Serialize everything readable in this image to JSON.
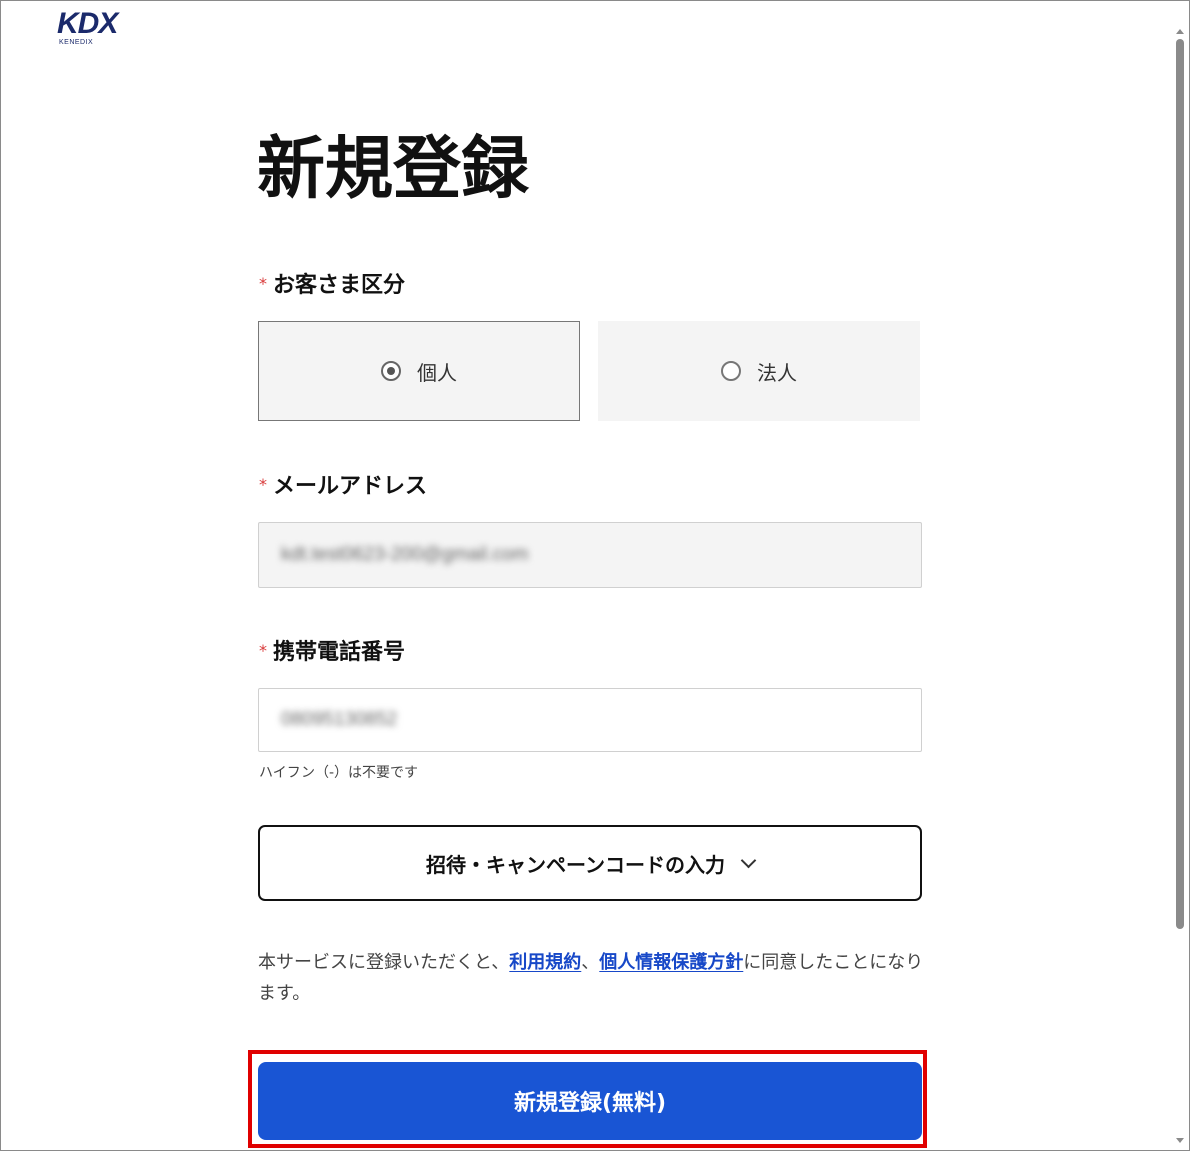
{
  "logo": {
    "mark": "KDX",
    "sub": "KENEDIX"
  },
  "page": {
    "title": "新規登録"
  },
  "form": {
    "required_mark": "*",
    "customer_type": {
      "label": "お客さま区分",
      "options": [
        {
          "label": "個人",
          "selected": true
        },
        {
          "label": "法人",
          "selected": false
        }
      ]
    },
    "email": {
      "label": "メールアドレス",
      "value": "kdt.test0623-200@gmail.com"
    },
    "phone": {
      "label": "携帯電話番号",
      "value": "08095130852",
      "hint": "ハイフン（-）は不要です"
    },
    "invite_button": {
      "label": "招待・キャンペーンコードの入力"
    },
    "terms": {
      "prefix": "本サービスに登録いただくと、",
      "link_terms": "利用規約",
      "separator": "、",
      "link_privacy": "個人情報保護方針",
      "suffix": "に同意したことになります。"
    },
    "submit_button": {
      "label": "新規登録(無料)"
    }
  },
  "colors": {
    "primary": "#1955d4",
    "required": "#d93a3a",
    "link": "#1748c8",
    "highlight": "#e00000",
    "logo": "#1b2a6b"
  }
}
